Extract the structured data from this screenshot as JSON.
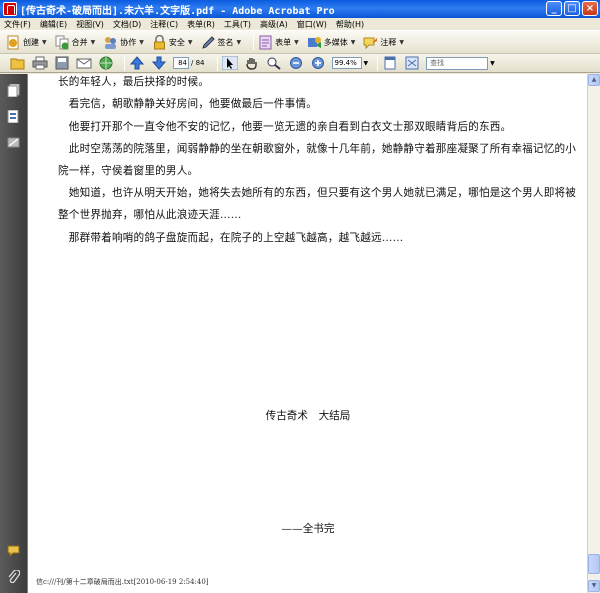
{
  "window": {
    "title": "[传古奇术-破局而出].未六羊.文字版.pdf - Adobe Acrobat Pro",
    "minimize": "_",
    "maximize": "□",
    "close": "×"
  },
  "menu": [
    "文件(F)",
    "编辑(E)",
    "视图(V)",
    "文档(D)",
    "注释(C)",
    "表单(R)",
    "工具(T)",
    "高级(A)",
    "窗口(W)",
    "帮助(H)"
  ],
  "toolbar": {
    "create": "创建",
    "combine": "合并",
    "collaborate": "协作",
    "secure": "安全",
    "sign": "签名",
    "forms": "表单",
    "multimedia": "多媒体",
    "comment": "注释"
  },
  "nav_toolbar": {
    "page_current": "84",
    "page_total": "/ 84",
    "zoom": "99.4%",
    "find_placeholder": "查找"
  },
  "document": {
    "lines": [
      "长的年轻人，最后抉择的时候。",
      "　看完信，朝歌静静关好房间，他要做最后一件事情。",
      "　他要打开那个一直令他不安的记忆，他要一览无遗的亲自看到白衣文士那双眼睛背后的东西。",
      "　此时空荡荡的院落里，闻弱静静的坐在朝歌窗外，就像十几年前，她静静守着那座凝聚了所有幸福记忆的小",
      "院一样，守侯着窗里的男人。",
      "　她知道，也许从明天开始，她将失去她所有的东西，但只要有这个男人她就已满足，哪怕是这个男人即将被",
      "整个世界抛弃，哪怕从此浪迹天涯……",
      "　那群带着响哨的鸽子盘旋而起，在院子的上空越飞越高，越飞越远……"
    ],
    "ending_title": "传古奇术　大结局",
    "ending_mark": "——全书完",
    "footer": "信c:///刊/第十二章破局而出.txt[2010-06-19 2:54:40]"
  },
  "colors": {
    "titlebar": "#0a5be0",
    "nav_panel": "#4a4a4a",
    "toolbar": "#ece9d8"
  }
}
